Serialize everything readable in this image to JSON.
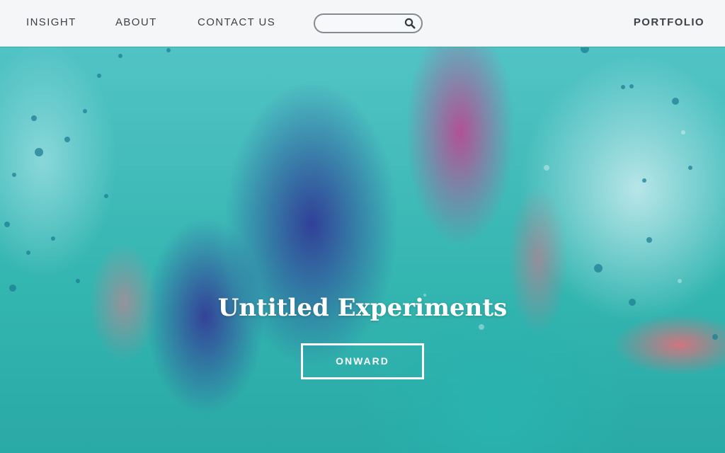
{
  "nav": {
    "links": [
      "INSIGHT",
      "ABOUT",
      "CONTACT US"
    ],
    "brand": "PORTFOLIO",
    "search": {
      "value": "",
      "placeholder": ""
    }
  },
  "hero": {
    "title": "Untitled Experiments",
    "button_label": "ONWARD"
  },
  "icons": {
    "search": "search-icon"
  },
  "colors": {
    "navbar_background": "#f5f6f8",
    "nav_text": "#3c4147",
    "hero_teal": "#33b5b0",
    "hero_blue": "#303a96",
    "hero_magenta": "#c43e8e",
    "hero_coral": "#ec6a76",
    "hero_text": "#ffffff"
  }
}
